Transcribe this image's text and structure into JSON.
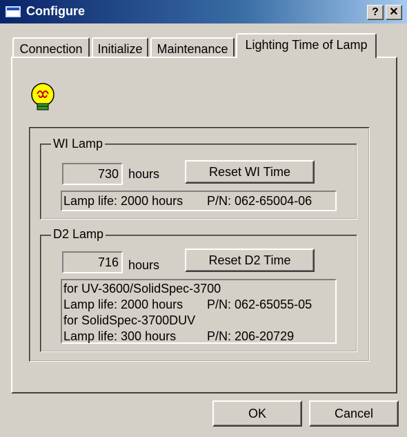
{
  "window": {
    "title": "Configure",
    "help_btn": "?",
    "close_btn": "✕"
  },
  "tabs": [
    {
      "label": "Connection",
      "active": false
    },
    {
      "label": "Initialize",
      "active": false
    },
    {
      "label": "Maintenance",
      "active": false
    },
    {
      "label": "Lighting Time of Lamp",
      "active": true
    }
  ],
  "lamp_icon": "light-bulb-icon",
  "wi": {
    "group_label": "WI Lamp",
    "hours_value": "730",
    "hours_unit": "hours",
    "reset_label": "Reset WI Time",
    "life": "Lamp life: 2000 hours",
    "pn": "P/N: 062-65004-06"
  },
  "d2": {
    "group_label": "D2 Lamp",
    "hours_value": "716",
    "hours_unit": "hours",
    "reset_label": "Reset D2 Time",
    "line1": "for UV-3600/SolidSpec-3700",
    "life1": "Lamp life: 2000 hours",
    "pn1": "P/N: 062-65055-05",
    "line2": "for SolidSpec-3700DUV",
    "life2": "Lamp life: 300 hours",
    "pn2": "P/N: 206-20729"
  },
  "buttons": {
    "ok": "OK",
    "cancel": "Cancel"
  }
}
